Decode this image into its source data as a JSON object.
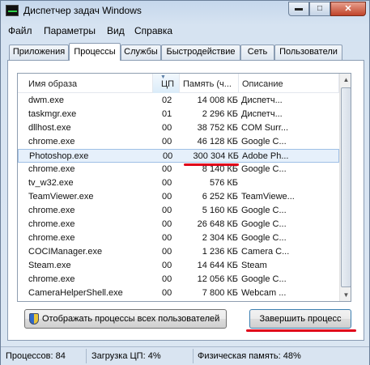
{
  "window": {
    "title": "Диспетчер задач Windows",
    "btn_min": "▬",
    "btn_max": "□",
    "btn_close": "✕"
  },
  "menu": [
    "Файл",
    "Параметры",
    "Вид",
    "Справка"
  ],
  "tabs": [
    "Приложения",
    "Процессы",
    "Службы",
    "Быстродействие",
    "Сеть",
    "Пользователи"
  ],
  "active_tab": "Процессы",
  "columns": {
    "name": "Имя образа",
    "cpu": "ЦП",
    "memory": "Память (ч...",
    "description": "Описание"
  },
  "sorted_column": "cpu",
  "processes": [
    {
      "name": "dwm.exe",
      "cpu": "02",
      "memory": "14 008 КБ",
      "description": "Диспетч..."
    },
    {
      "name": "taskmgr.exe",
      "cpu": "01",
      "memory": "2 296 КБ",
      "description": "Диспетч..."
    },
    {
      "name": "dllhost.exe",
      "cpu": "00",
      "memory": "38 752 КБ",
      "description": "COM Surr..."
    },
    {
      "name": "chrome.exe",
      "cpu": "00",
      "memory": "46 128 КБ",
      "description": "Google C..."
    },
    {
      "name": "Photoshop.exe",
      "cpu": "00",
      "memory": "300 304 КБ",
      "description": "Adobe Ph..."
    },
    {
      "name": "chrome.exe",
      "cpu": "00",
      "memory": "8 140 КБ",
      "description": "Google C..."
    },
    {
      "name": "tv_w32.exe",
      "cpu": "00",
      "memory": "576 КБ",
      "description": ""
    },
    {
      "name": "TeamViewer.exe",
      "cpu": "00",
      "memory": "6 252 КБ",
      "description": "TeamViewe..."
    },
    {
      "name": "chrome.exe",
      "cpu": "00",
      "memory": "5 160 КБ",
      "description": "Google C..."
    },
    {
      "name": "chrome.exe",
      "cpu": "00",
      "memory": "26 648 КБ",
      "description": "Google C..."
    },
    {
      "name": "chrome.exe",
      "cpu": "00",
      "memory": "2 304 КБ",
      "description": "Google C..."
    },
    {
      "name": "COCIManager.exe",
      "cpu": "00",
      "memory": "1 236 КБ",
      "description": "Camera C..."
    },
    {
      "name": "Steam.exe",
      "cpu": "00",
      "memory": "14 644 КБ",
      "description": "Steam"
    },
    {
      "name": "chrome.exe",
      "cpu": "00",
      "memory": "12 056 КБ",
      "description": "Google C..."
    },
    {
      "name": "CameraHelperShell.exe",
      "cpu": "00",
      "memory": "7 800 КБ",
      "description": "Webcam ..."
    }
  ],
  "selected_process": "Photoshop.exe",
  "buttons": {
    "show_all": "Отображать процессы всех пользователей",
    "end_process": "Завершить процесс"
  },
  "status": {
    "processes": "Процессов: 84",
    "cpu_load": "Загрузка ЦП: 4%",
    "physical_memory": "Физическая память: 48%"
  },
  "annotation_color": "#e00019"
}
